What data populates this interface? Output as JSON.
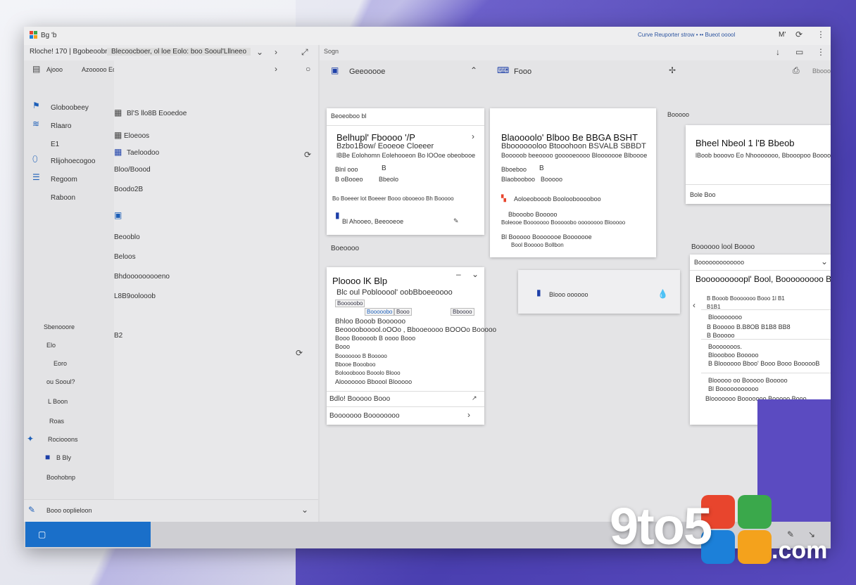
{
  "title_bar": {
    "app_name": "Bg 'b",
    "right_text": "Curve Reuporter strow • ••  Bueot ooool",
    "right_m": "M'"
  },
  "address": {
    "path": "Rloche! 170 | Bgobeoobrg",
    "search_text": "Blecoocboer, ol loe Eolo: boo Sooul'Lllneeo",
    "right_label": "Sogn"
  },
  "nav": {
    "header_label": "Ajooo",
    "header_value": "Azooooo Eooo",
    "items": [
      "Globoobeey",
      "Rlaaro",
      "E1",
      "Rlijohoecogoo",
      "Regoom",
      "Raboon"
    ],
    "lower_items": [
      "Sbenooore",
      "Elo",
      "Eoro",
      "ou Sooul?",
      "L Boon",
      "Roas",
      "Rociooons",
      "B Bly",
      "Boohobnp"
    ]
  },
  "files": {
    "items": [
      "Bl'S llo8B Eooedoe",
      "Eloeoos",
      "Taeloodoo",
      "Bloo/Boood",
      "Boodo2B",
      "Beooblo",
      "Beloos",
      "Bhdooooooooeno",
      "L8B9oolooob",
      "B2"
    ]
  },
  "status": {
    "text": "Booo ooplieloon"
  },
  "panels": {
    "p1": {
      "title": "Geeooooe",
      "subtitle": "Beoeoboo bl"
    },
    "p2": {
      "title": "Fooo"
    },
    "p3": {
      "title": "Booooo",
      "icon_label": "Bbooo"
    }
  },
  "cards": {
    "c1": {
      "title": "Belhupl' Fboooo '/P",
      "l2": "Bzbo1Bow/ Eooeoe Cloeeer",
      "l3": "lBBe Eolohomn Eolehooeon  Bo  lOOoe obeobooe",
      "r1": "Blnl ooo",
      "r1v": "B",
      "r2": "B oBooeo",
      "r2v": "Bbeolo",
      "l6": "Bo Boeeer lot Boeeer Booo obooeoo Bh Booooo",
      "foot": "Bl Ahooeo, Beeooeoe"
    },
    "c2": {
      "title": "Blaoooolo' Blboo Be BBGA BSHT",
      "l2": "Bbooooooloo Btooohoon BSVALB SBBDT",
      "l3": "Booooob beeoooo gooooeoooo Blooooooe Blboooe",
      "r1": "Bboeboo",
      "r1v": "B",
      "r2": "Blaobooboo",
      "r2v": "Booooo",
      "l6": "Aoloeobooob Booloobooooboo",
      "l7": "Bbooobo Booooo",
      "l8": "Boleooe Booooooo Booooobo oooooooo Blooooo",
      "l9": "Bl Booooo Booooooe Booooooe",
      "l10": "Bool Booooo Bollbon"
    },
    "c3": {
      "title": "Bheel  Nbeol  1 l'B  Bbeob",
      "l2": "lBoob booovo  Eo  Nhooooooo,  Bbooopoo  Booooe",
      "foot": "Bole Boo"
    },
    "c4": {
      "title": "Ploooo lK Blp",
      "l2": "Blc oul Poblooool' oobBboeeoooo",
      "chips": [
        "Booooobo",
        "Booooobo",
        "Booo",
        "Bboooo"
      ],
      "l4": "Bhloo Booob  Boooooo",
      "l5": "Beoooobooool.oOOo ,  Bbooeoooo  BOOOo  Booooo",
      "l6": "Booo Booooob  B oooo  Booo",
      "l7": "Booo",
      "l8": "Booooooo   B   Booooo",
      "l9": "Bbooe Boooboo",
      "l10": "Bolooobooo Booolo Blooo",
      "l11": "Alooooooo Bboool Blooooo",
      "foot1": "Bdlo! Booooo Booo",
      "foot2": "Booooooo Boooooooo"
    },
    "c5": {
      "label": "Blooo oooooo"
    },
    "c6": {
      "header": "Booooooooooooo",
      "title": "Booooooooopl' Bool, Booooooooo  Booo",
      "l2": "B  Booob  Booooooo  Booo  1l B1",
      "l3": "B1B1",
      "l4": "Bloooooooo",
      "l5": "B Booooo  B.B8OB  B1B8  BB8",
      "l6": "B  Booooo",
      "l7": "Booooooos.",
      "l8": "Bloooboo  Booooo",
      "l9": "B  Bloooooo  Bboo'  Booo  Booo  BoooooB",
      "l10": "Blooooo  oo  Booooo  Booooo",
      "l11": "Bl  Booooooooooo",
      "l12": "Blooooooo  Booooooo  Booooo  Booo"
    },
    "section": "Boeoooo",
    "section2": "Boooooo lool  Boooo"
  },
  "watermark": {
    "numbers": "9to5",
    "domain": ".com",
    "colors": [
      "#e8452d",
      "#f4a21c",
      "#3aa84b",
      "#1c80d9"
    ]
  }
}
